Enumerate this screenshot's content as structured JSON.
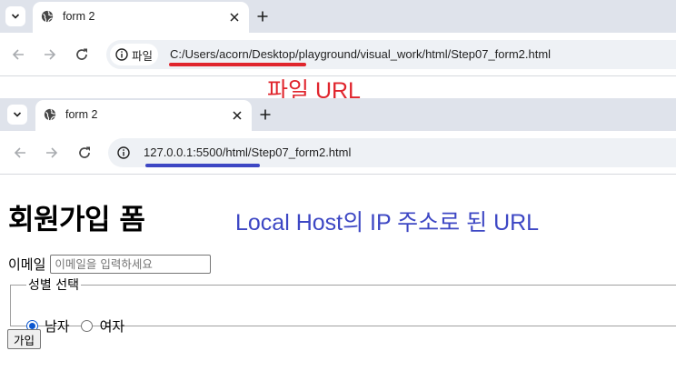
{
  "browser_top": {
    "tab_title": "form 2",
    "site_chip_label": "파일",
    "url": "C:/Users/acorn/Desktop/playground/visual_work/html/Step07_form2.html"
  },
  "annotation_top": {
    "text": "파일 URL",
    "color": "#e0252d"
  },
  "browser_bottom": {
    "tab_title": "form 2",
    "url": "127.0.0.1:5500/html/Step07_form2.html"
  },
  "annotation_bottom": {
    "text": "Local Host의 IP 주소로 된 URL",
    "color": "#3d47c4"
  },
  "page": {
    "heading": "회원가입 폼",
    "email_label": "이메일",
    "email_placeholder": "이메일을 입력하세요",
    "email_value": "",
    "gender_legend": "성별 선택",
    "gender_options": [
      {
        "label": "남자",
        "checked": true
      },
      {
        "label": "여자",
        "checked": false
      }
    ],
    "submit_label": "가입"
  },
  "colors": {
    "tabstrip": "#dfe3eb",
    "omnibox": "#eef1f5",
    "radio_accent": "#0b57d0"
  }
}
